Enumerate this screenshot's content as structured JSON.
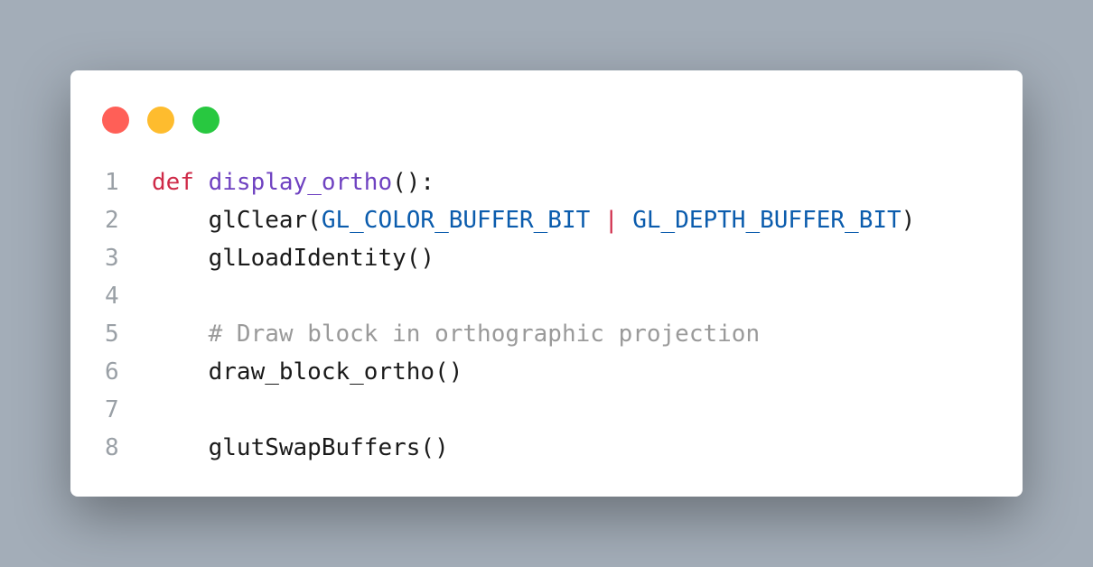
{
  "window": {
    "controls": [
      {
        "name": "close",
        "color": "#ff5f57"
      },
      {
        "name": "minimize",
        "color": "#febc2e"
      },
      {
        "name": "maximize",
        "color": "#28c840"
      }
    ]
  },
  "code": {
    "lines": [
      {
        "number": "1",
        "tokens": [
          {
            "text": "def",
            "type": "kw"
          },
          {
            "text": " ",
            "type": "text"
          },
          {
            "text": "display_ortho",
            "type": "fn"
          },
          {
            "text": "():",
            "type": "text"
          }
        ]
      },
      {
        "number": "2",
        "tokens": [
          {
            "text": "    glClear(",
            "type": "text"
          },
          {
            "text": "GL_COLOR_BUFFER_BIT",
            "type": "const"
          },
          {
            "text": " ",
            "type": "text"
          },
          {
            "text": "|",
            "type": "op"
          },
          {
            "text": " ",
            "type": "text"
          },
          {
            "text": "GL_DEPTH_BUFFER_BIT",
            "type": "const"
          },
          {
            "text": ")",
            "type": "text"
          }
        ]
      },
      {
        "number": "3",
        "tokens": [
          {
            "text": "    glLoadIdentity()",
            "type": "text"
          }
        ]
      },
      {
        "number": "4",
        "tokens": []
      },
      {
        "number": "5",
        "tokens": [
          {
            "text": "    ",
            "type": "text"
          },
          {
            "text": "# Draw block in orthographic projection",
            "type": "comment"
          }
        ]
      },
      {
        "number": "6",
        "tokens": [
          {
            "text": "    draw_block_ortho()",
            "type": "text"
          }
        ]
      },
      {
        "number": "7",
        "tokens": []
      },
      {
        "number": "8",
        "tokens": [
          {
            "text": "    glutSwapBuffers()",
            "type": "text"
          }
        ]
      }
    ]
  }
}
